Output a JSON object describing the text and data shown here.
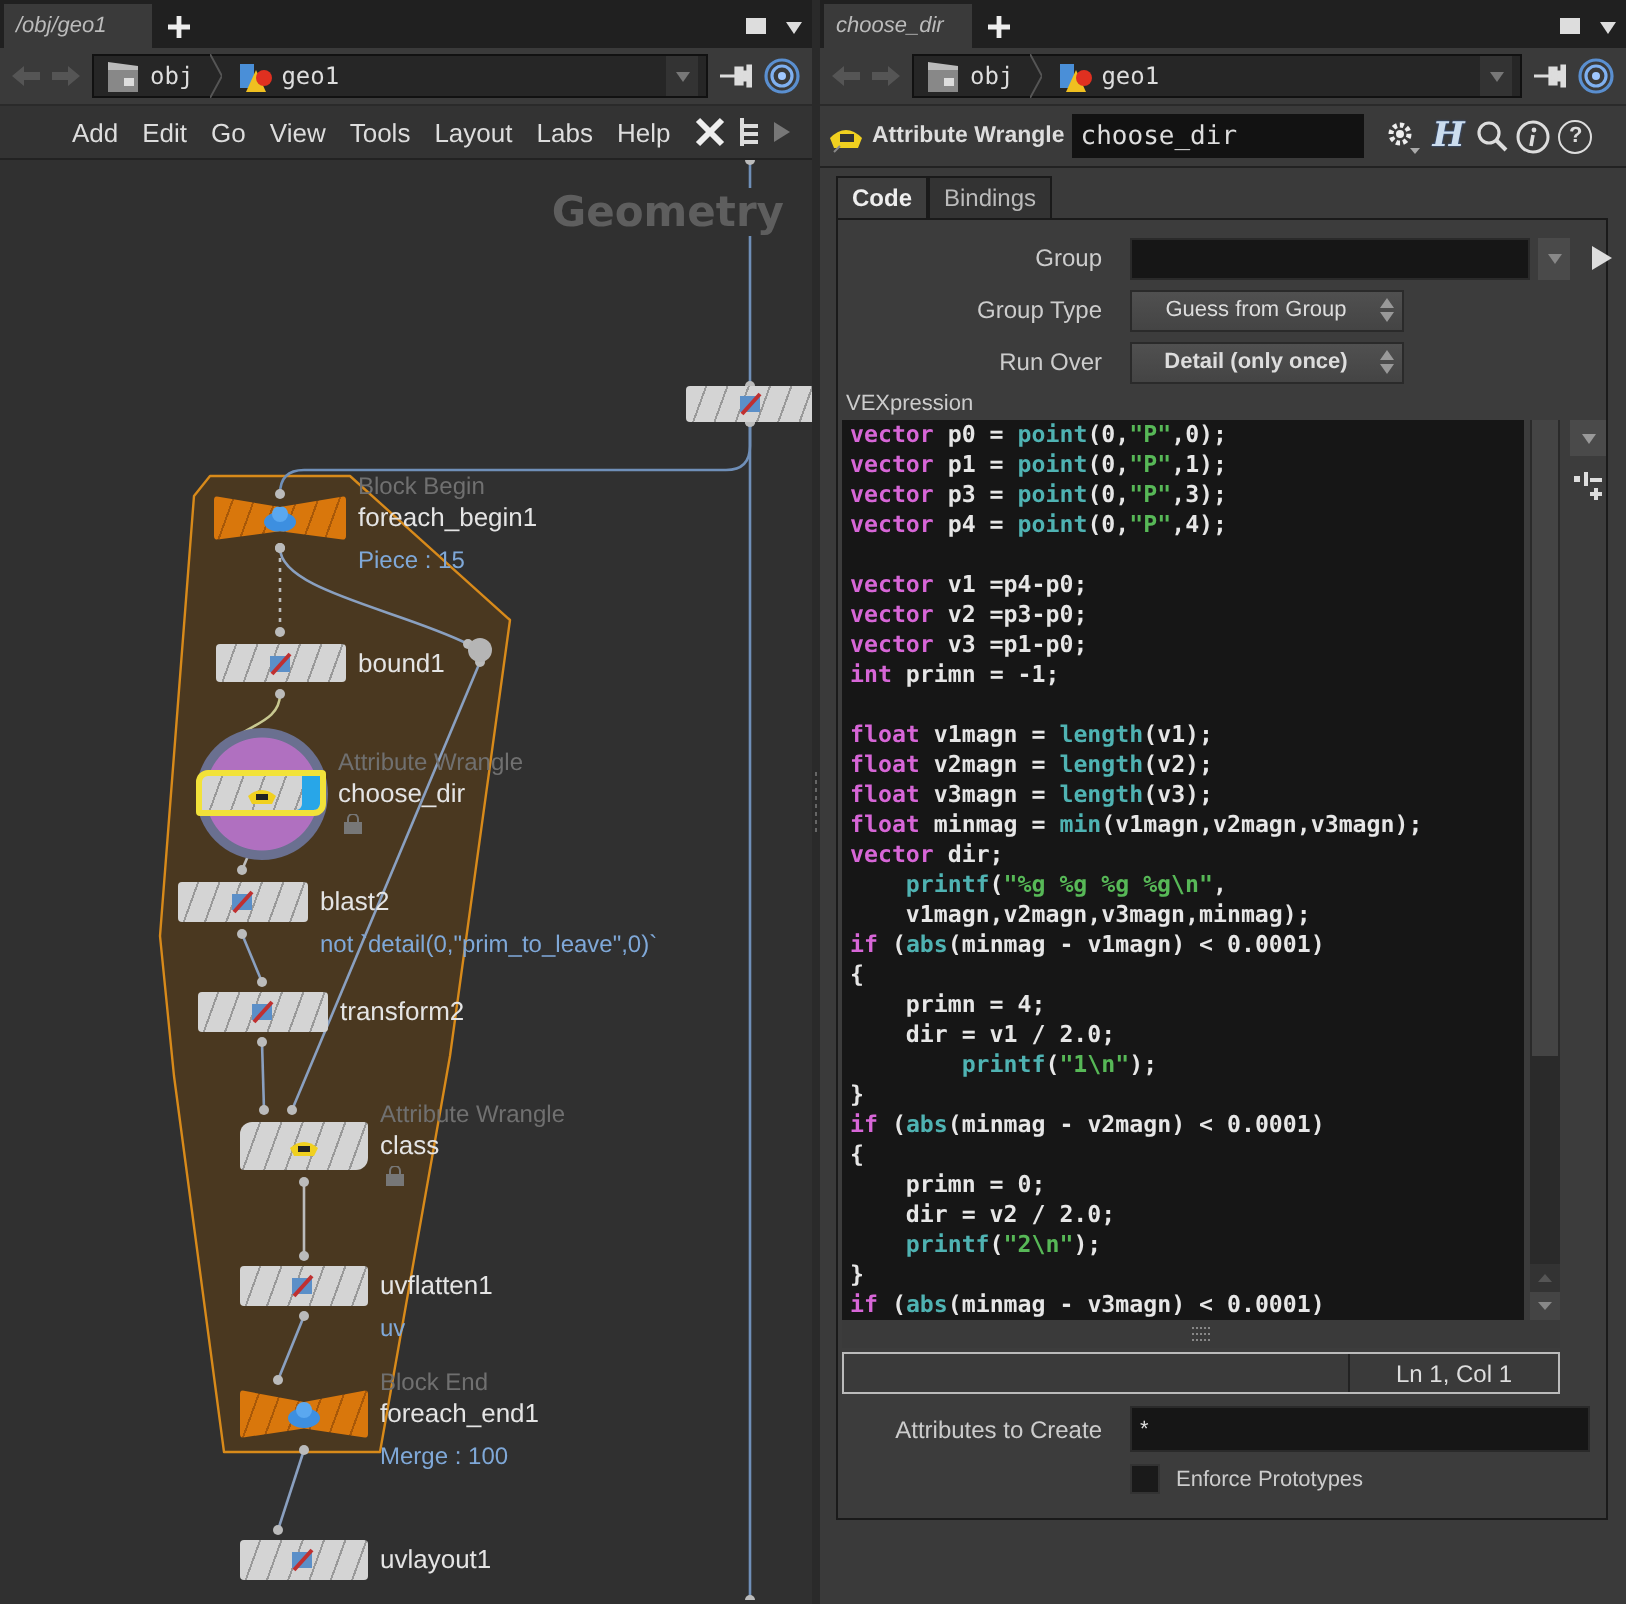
{
  "network_pane": {
    "tab": {
      "label": "/obj/geo1",
      "selected": true
    },
    "path": [
      "obj",
      "geo1"
    ],
    "menu": [
      "Add",
      "Edit",
      "Go",
      "View",
      "Tools",
      "Layout",
      "Labs",
      "Help"
    ],
    "context_label": "Geometry",
    "nodes": [
      {
        "kind": "sop"
      },
      {
        "kind": "block",
        "type_label": "Block Begin",
        "name": "foreach_begin1",
        "info": "Piece : 15"
      },
      {
        "kind": "sop",
        "name": "bound1"
      },
      {
        "kind": "wrangle",
        "type_label": "Attribute Wrangle",
        "name": "choose_dir",
        "locked": true,
        "selected": true,
        "display": true
      },
      {
        "kind": "sop",
        "name": "blast2",
        "info": "not `detail(0,\"prim_to_leave\",0)`"
      },
      {
        "kind": "sop",
        "name": "transform2"
      },
      {
        "kind": "wrangle",
        "type_label": "Attribute Wrangle",
        "name": "class",
        "locked": true,
        "selected": false,
        "display": false
      },
      {
        "kind": "sop",
        "name": "uvflatten1",
        "info": "uv"
      },
      {
        "kind": "block",
        "type_label": "Block End",
        "name": "foreach_end1",
        "info": "Merge : 100"
      },
      {
        "kind": "sop",
        "name": "uvlayout1"
      }
    ]
  },
  "parameter_pane": {
    "tab": {
      "label": "choose_dir",
      "selected": true
    },
    "path": [
      "obj",
      "geo1"
    ],
    "node_type": "Attribute Wrangle",
    "node_name": "choose_dir",
    "h_button": "H",
    "help_button": "?",
    "tabs": [
      {
        "label": "Code",
        "selected": true
      },
      {
        "label": "Bindings",
        "selected": false
      }
    ],
    "params": [
      {
        "kind": "field",
        "label": "Group"
      },
      {
        "kind": "menu",
        "label": "Group Type",
        "value": "Guess from Group",
        "modified": false
      },
      {
        "kind": "menu",
        "label": "Run Over",
        "value": "Detail (only once)",
        "modified": true
      }
    ],
    "vex_label": "VEXpression",
    "code": [
      {
        "kind": "code",
        "segments": [
          {
            "kind": "kw",
            "t": "vector"
          },
          {
            "kind": "pl",
            "t": " p0 = "
          },
          {
            "kind": "fn",
            "t": "point"
          },
          {
            "kind": "pl",
            "t": "(0,"
          },
          {
            "kind": "str",
            "t": "\"P\""
          },
          {
            "kind": "pl",
            "t": ",0);"
          }
        ]
      },
      {
        "kind": "code",
        "segments": [
          {
            "kind": "kw",
            "t": "vector"
          },
          {
            "kind": "pl",
            "t": " p1 = "
          },
          {
            "kind": "fn",
            "t": "point"
          },
          {
            "kind": "pl",
            "t": "(0,"
          },
          {
            "kind": "str",
            "t": "\"P\""
          },
          {
            "kind": "pl",
            "t": ",1);"
          }
        ]
      },
      {
        "kind": "code",
        "segments": [
          {
            "kind": "kw",
            "t": "vector"
          },
          {
            "kind": "pl",
            "t": " p3 = "
          },
          {
            "kind": "fn",
            "t": "point"
          },
          {
            "kind": "pl",
            "t": "(0,"
          },
          {
            "kind": "str",
            "t": "\"P\""
          },
          {
            "kind": "pl",
            "t": ",3);"
          }
        ]
      },
      {
        "kind": "code",
        "segments": [
          {
            "kind": "kw",
            "t": "vector"
          },
          {
            "kind": "pl",
            "t": " p4 = "
          },
          {
            "kind": "fn",
            "t": "point"
          },
          {
            "kind": "pl",
            "t": "(0,"
          },
          {
            "kind": "str",
            "t": "\"P\""
          },
          {
            "kind": "pl",
            "t": ",4);"
          }
        ]
      },
      {
        "kind": "blank"
      },
      {
        "kind": "code",
        "segments": [
          {
            "kind": "kw",
            "t": "vector"
          },
          {
            "kind": "pl",
            "t": " v1 =p4-p0;"
          }
        ]
      },
      {
        "kind": "code",
        "segments": [
          {
            "kind": "kw",
            "t": "vector"
          },
          {
            "kind": "pl",
            "t": " v2 =p3-p0;"
          }
        ]
      },
      {
        "kind": "code",
        "segments": [
          {
            "kind": "kw",
            "t": "vector"
          },
          {
            "kind": "pl",
            "t": " v3 =p1-p0;"
          }
        ]
      },
      {
        "kind": "code",
        "segments": [
          {
            "kind": "kw",
            "t": "int"
          },
          {
            "kind": "pl",
            "t": " primn = -1;"
          }
        ]
      },
      {
        "kind": "blank"
      },
      {
        "kind": "code",
        "segments": [
          {
            "kind": "kw",
            "t": "float"
          },
          {
            "kind": "pl",
            "t": " v1magn = "
          },
          {
            "kind": "fn",
            "t": "length"
          },
          {
            "kind": "pl",
            "t": "(v1);"
          }
        ]
      },
      {
        "kind": "code",
        "segments": [
          {
            "kind": "kw",
            "t": "float"
          },
          {
            "kind": "pl",
            "t": " v2magn = "
          },
          {
            "kind": "fn",
            "t": "length"
          },
          {
            "kind": "pl",
            "t": "(v2);"
          }
        ]
      },
      {
        "kind": "code",
        "segments": [
          {
            "kind": "kw",
            "t": "float"
          },
          {
            "kind": "pl",
            "t": " v3magn = "
          },
          {
            "kind": "fn",
            "t": "length"
          },
          {
            "kind": "pl",
            "t": "(v3);"
          }
        ]
      },
      {
        "kind": "code",
        "segments": [
          {
            "kind": "kw",
            "t": "float"
          },
          {
            "kind": "pl",
            "t": " minmag = "
          },
          {
            "kind": "fn",
            "t": "min"
          },
          {
            "kind": "pl",
            "t": "(v1magn,v2magn,v3magn);"
          }
        ]
      },
      {
        "kind": "code",
        "segments": [
          {
            "kind": "kw",
            "t": "vector"
          },
          {
            "kind": "pl",
            "t": " dir;"
          }
        ]
      },
      {
        "kind": "code_indent",
        "segments": [
          {
            "kind": "fn",
            "t": "printf"
          },
          {
            "kind": "pl",
            "t": "("
          },
          {
            "kind": "str",
            "t": "\"%g %g %g %g\\n\""
          },
          {
            "kind": "pl",
            "t": ","
          }
        ]
      },
      {
        "kind": "code",
        "segments": [
          {
            "kind": "pl",
            "t": "    v1magn,v2magn,v3magn,minmag);"
          }
        ]
      },
      {
        "kind": "code",
        "segments": [
          {
            "kind": "kw",
            "t": "if"
          },
          {
            "kind": "pl",
            "t": " ("
          },
          {
            "kind": "fn",
            "t": "abs"
          },
          {
            "kind": "pl",
            "t": "(minmag - v1magn) < 0.0001)"
          }
        ]
      },
      {
        "kind": "code",
        "segments": [
          {
            "kind": "pl",
            "t": "{"
          }
        ]
      },
      {
        "kind": "code",
        "segments": [
          {
            "kind": "pl",
            "t": "    primn = 4;"
          }
        ]
      },
      {
        "kind": "code",
        "segments": [
          {
            "kind": "pl",
            "t": "    dir = v1 / 2.0;"
          }
        ]
      },
      {
        "kind": "code_indent2",
        "segments": [
          {
            "kind": "fn",
            "t": "printf"
          },
          {
            "kind": "pl",
            "t": "("
          },
          {
            "kind": "str",
            "t": "\"1\\n\""
          },
          {
            "kind": "pl",
            "t": ");"
          }
        ]
      },
      {
        "kind": "code",
        "segments": [
          {
            "kind": "pl",
            "t": "}"
          }
        ]
      },
      {
        "kind": "code",
        "segments": [
          {
            "kind": "kw",
            "t": "if"
          },
          {
            "kind": "pl",
            "t": " ("
          },
          {
            "kind": "fn",
            "t": "abs"
          },
          {
            "kind": "pl",
            "t": "(minmag - v2magn) < 0.0001)"
          }
        ]
      },
      {
        "kind": "code",
        "segments": [
          {
            "kind": "pl",
            "t": "{"
          }
        ]
      },
      {
        "kind": "code",
        "segments": [
          {
            "kind": "pl",
            "t": "    primn = 0;"
          }
        ]
      },
      {
        "kind": "code",
        "segments": [
          {
            "kind": "pl",
            "t": "    dir = v2 / 2.0;"
          }
        ]
      },
      {
        "kind": "code_indent",
        "segments": [
          {
            "kind": "fn",
            "t": "printf"
          },
          {
            "kind": "pl",
            "t": "("
          },
          {
            "kind": "str",
            "t": "\"2\\n\""
          },
          {
            "kind": "pl",
            "t": ");"
          }
        ]
      },
      {
        "kind": "code",
        "segments": [
          {
            "kind": "pl",
            "t": "}"
          }
        ]
      },
      {
        "kind": "code",
        "segments": [
          {
            "kind": "kw",
            "t": "if"
          },
          {
            "kind": "pl",
            "t": " ("
          },
          {
            "kind": "fn",
            "t": "abs"
          },
          {
            "kind": "pl",
            "t": "(minmag - v3magn) < 0.0001)"
          }
        ]
      }
    ],
    "cursor": "Ln 1, Col 1",
    "attributes_to_create": {
      "label": "Attributes to Create",
      "value": "*"
    },
    "enforce_prototypes": {
      "label": "Enforce Prototypes",
      "checked": false
    }
  }
}
